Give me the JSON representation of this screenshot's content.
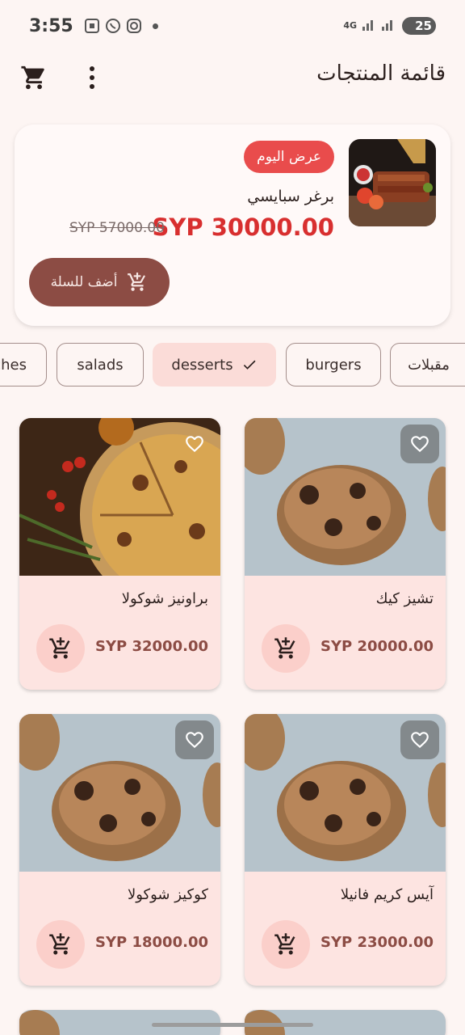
{
  "status_bar": {
    "time": "3:55",
    "network": "4G",
    "battery": "25"
  },
  "app_bar": {
    "title": "قائمة المنتجات"
  },
  "offer": {
    "badge": "عرض اليوم",
    "name": "برغر سبايسي",
    "price": "SYP 30000.00",
    "old_price": "SYP 57000.00",
    "add_button": "أضف للسلة"
  },
  "categories": [
    {
      "label": "مقبلات",
      "selected": false
    },
    {
      "label": "burgers",
      "selected": false
    },
    {
      "label": "desserts",
      "selected": true
    },
    {
      "label": "salads",
      "selected": false
    },
    {
      "label": "ches",
      "selected": false
    }
  ],
  "products": [
    {
      "name": "تشيز كيك",
      "price": "SYP 20000.00",
      "image": "cookie"
    },
    {
      "name": "براونيز شوكولا",
      "price": "SYP 32000.00",
      "image": "pizza"
    },
    {
      "name": "آيس كريم فانيلا",
      "price": "SYP 23000.00",
      "image": "cookie"
    },
    {
      "name": "كوكيز شوكولا",
      "price": "SYP 18000.00",
      "image": "cookie"
    }
  ],
  "colors": {
    "accent": "#8c4c44",
    "sale": "#d82f2f",
    "chip_selected": "#fbdcd8",
    "card_bg": "#fde4e1"
  }
}
